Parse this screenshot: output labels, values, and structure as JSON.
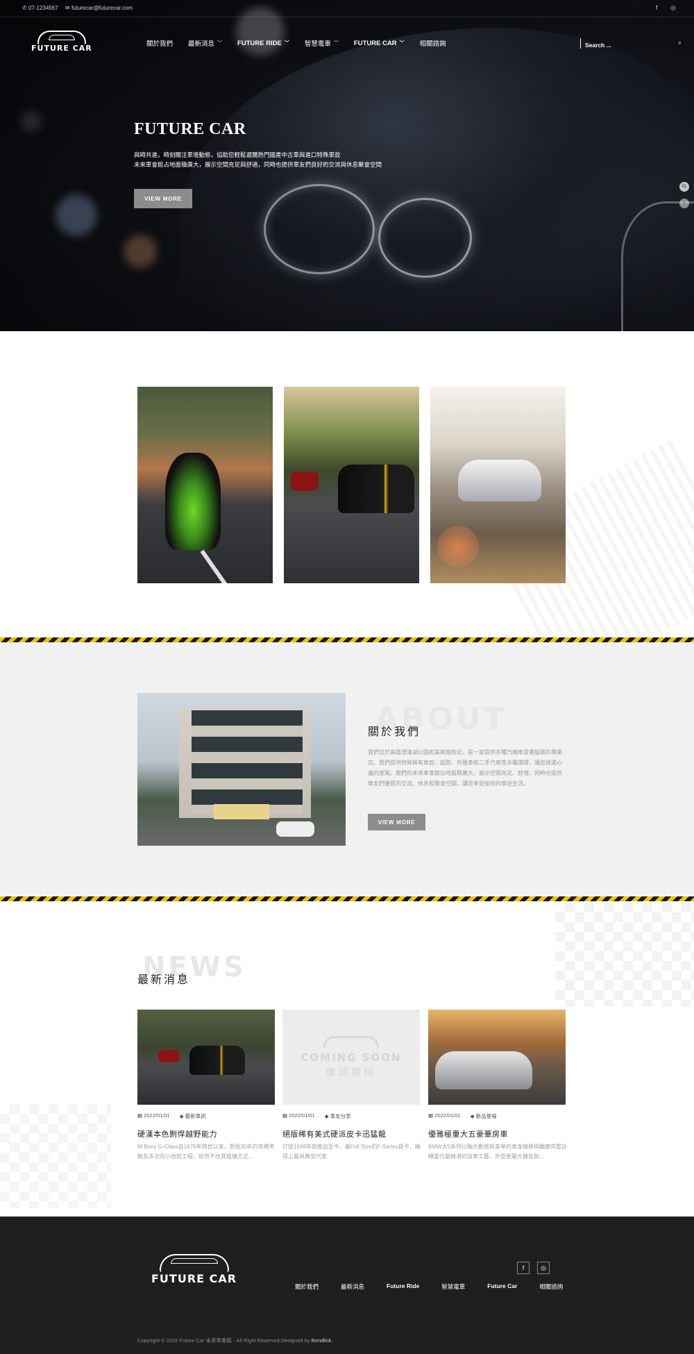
{
  "topbar": {
    "phone": "07-1234567",
    "email": "futurecar@futurecar.com"
  },
  "brand": {
    "logo_text": "FUTURE CAR"
  },
  "nav": {
    "items": [
      {
        "label": "關於我們"
      },
      {
        "label": "最新消息"
      },
      {
        "label": "FUTURE RIDE"
      },
      {
        "label": "智慧電車"
      },
      {
        "label": "FUTURE CAR"
      },
      {
        "label": "相關諮詢"
      }
    ],
    "search_placeholder": "Search ..."
  },
  "hero": {
    "title": "FUTURE CAR",
    "line1": "與時共進，時刻關注車壇動態，協助您輕鬆選購熱門國產中古車與進口特殊車款",
    "line2": "未來車會館占地面積廣大，展示空間充足與舒適，同時也提供車友們良好的交流與休息聚會空間",
    "button": "VIEW MORE",
    "slide_current": "01"
  },
  "about": {
    "ghost": "ABOUT",
    "title": "關於我們",
    "text": "我們位於高雄澄清湖公園和美術館附近，是一家提供多種汽機車買賣服務的專業店。我們提供特殊稀有車款、超跑、外匯車和二手汽車等多種選擇，讓您挑選心儀的座駕。我們的未來車會館佔地面積廣大，展示空間充足、舒適，同時也提供車友們優質的交流、休息和聚會空間，讓您享受愉悅的車迷生活。",
    "button": "VIEW MORE"
  },
  "news": {
    "ghost": "NEWS",
    "title": "最新消息",
    "coming_soon_en": "COMING SOON",
    "coming_soon_zh": "敬請期待",
    "items": [
      {
        "date": "2022/01/01",
        "tag": "最新車訊",
        "title": "硬漢本色剽悍越野能力",
        "excerpt": "M-Benz G-Class自1979年問世以來，歷經30年的市場考驗及多次的小改款工程，依然不改其粗獷方正..."
      },
      {
        "date": "2022/01/01",
        "tag": "車友分享",
        "title": "絕版稀有美式硬派皮卡迅猛龍",
        "excerpt": "打從1948年就推出至今，屬Full Size的F-Series貨卡，稱得上最具典型代表"
      },
      {
        "date": "2022/01/01",
        "tag": "新品登場",
        "title": "優雅極重大五豪華房車",
        "excerpt": "BMW大5系列以融合動感與美學的車身線條與輪廓完整詮釋當代最精湛的造車工藝，外型更顯大器並創..."
      }
    ]
  },
  "footer": {
    "links": [
      {
        "label": "關於我們",
        "bold": false
      },
      {
        "label": "最新消息",
        "bold": false
      },
      {
        "label": "Future Ride",
        "bold": true
      },
      {
        "label": "智慧電車",
        "bold": false
      },
      {
        "label": "Future Car",
        "bold": true
      },
      {
        "label": "相關諮詢",
        "bold": false
      }
    ],
    "copyright": "Copyright © 2022 Future Car 未來車會館 - All Right Reserved.Designed by",
    "designer": "Bondlink."
  },
  "colors": {
    "footer_bg": "#1f1f21",
    "caution_yellow": "#f2c200",
    "button_grey": "#8c8c8c"
  }
}
